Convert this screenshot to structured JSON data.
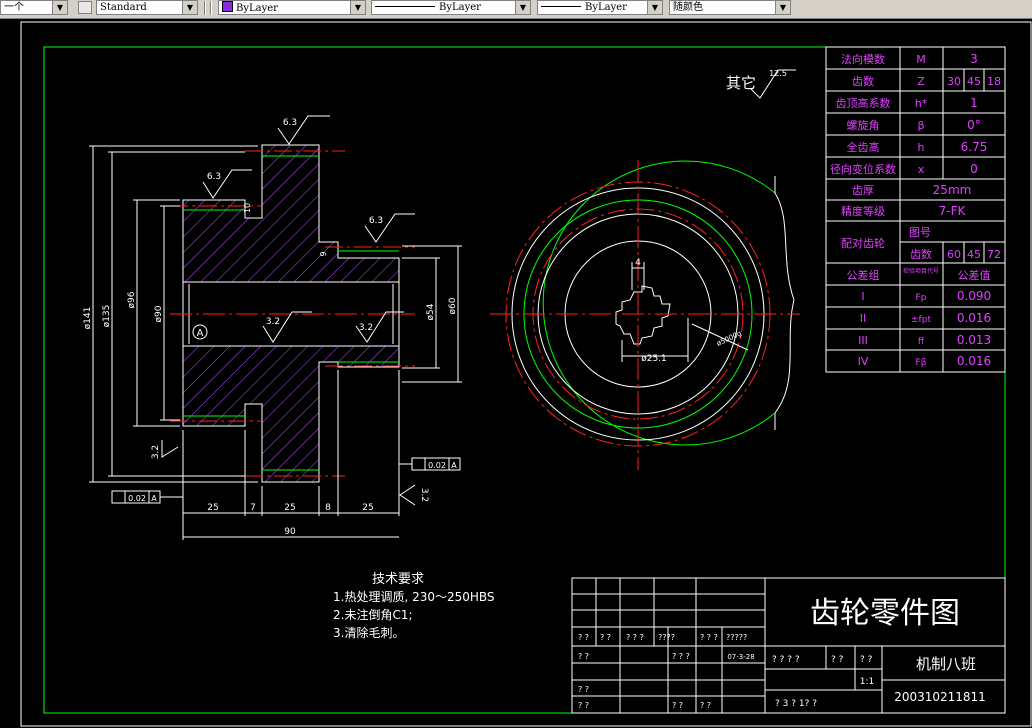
{
  "toolbar": {
    "first_field": "一个",
    "text_style": "Standard",
    "layer": "ByLayer",
    "linetype": "ByLayer",
    "lineweight": "ByLayer",
    "color": "随颜色"
  },
  "colors": {
    "border": "#00ff00",
    "hatch": "#b44cff",
    "center": "#ff2020",
    "text": "#ffffff",
    "spec_text": "#e040ff",
    "table_bg": "#000000"
  },
  "annotations": {
    "other_roughness_label": "其它",
    "other_roughness_value": "12.5",
    "roughness_63": "6.3",
    "roughness_32": "3.2",
    "datum": "A",
    "tol_value": "0.02",
    "dim_10": "10",
    "dim_9": "9",
    "dia_141": "ø141",
    "dia_135": "ø135",
    "dia_96": "ø96",
    "dia_90": "ø90",
    "dia_54": "ø54",
    "dia_60": "ø60",
    "dim_25a": "25",
    "dim_7": "7",
    "dim_25b": "25",
    "dim_8": "8",
    "dim_25c": "25",
    "dim_90": "90",
    "key_4": "4",
    "bore_25": "ø25.1",
    "pcd_label": "ø5000g"
  },
  "tech_req": {
    "title": "技术要求",
    "items": [
      "1.热处理调质, 230～250HBS",
      "2.未注倒角C1;",
      "3.清除毛刺。"
    ]
  },
  "spec_table": {
    "rows": [
      [
        "法向模数",
        "M",
        "3"
      ],
      [
        "齿数",
        "Z",
        "30 45 18"
      ],
      [
        "齿顶高系数",
        "h*",
        "1"
      ],
      [
        "螺旋角",
        "β",
        "0°"
      ],
      [
        "全齿高",
        "h",
        "6.75"
      ],
      [
        "径向变位系数",
        "x",
        "0"
      ]
    ],
    "thickness_label": "齿厚",
    "thickness_value": "25mm",
    "precision_label": "精度等级",
    "precision_value": "7-FK",
    "mating_label": "配对齿轮",
    "drawing_no_label": "图号",
    "mating_teeth_label": "齿数",
    "mating_teeth_value": "60 45 72",
    "tol_group_label": "公差组",
    "tol_item_label": "检验项目代号",
    "tol_value_label": "公差值",
    "tol_rows": [
      [
        "I",
        "Fp",
        "0.090"
      ],
      [
        "II",
        "±fpt",
        "0.016"
      ],
      [
        "III",
        "ff",
        "0.013"
      ],
      [
        "IV",
        "Fβ",
        "0.016"
      ]
    ]
  },
  "title_block": {
    "title": "齿轮零件图",
    "class_name": "机制八班",
    "student_no": "200310211811",
    "scale": "1:1",
    "date": "07-3-28",
    "q2": "? ?",
    "q3": "? ? ?",
    "q4": "????",
    "q5": "?????",
    "q6": "? ? ? ?",
    "sheet_info": "? 3   ? 1?   ?"
  }
}
